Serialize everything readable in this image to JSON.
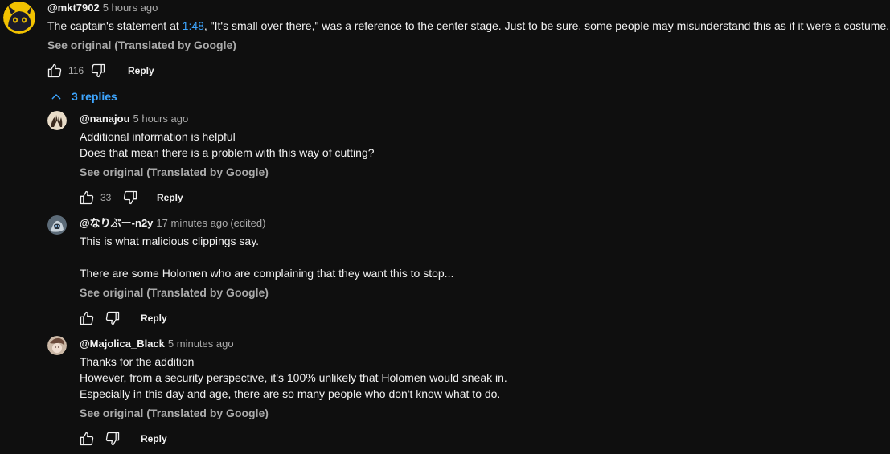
{
  "top_comment": {
    "author": "@mkt7902",
    "time": "5 hours ago",
    "text_before": "The captain's statement at ",
    "timestamp": "1:48",
    "text_after": ", \"It's small over there,\" was a reference to the center stage. Just to be sure, some people may misunderstand this as if it were a costume.",
    "see_original": "See original (Translated by Google)",
    "likes": "116",
    "reply_label": "Reply"
  },
  "replies_toggle": {
    "label": "3 replies",
    "icon": "chevron-up-icon"
  },
  "replies": [
    {
      "author": "@nanajou",
      "time": "5 hours ago",
      "lines": [
        "Additional information is helpful",
        "Does that mean there is a problem with this way of cutting?"
      ],
      "see_original": "See original (Translated by Google)",
      "likes": "33",
      "reply_label": "Reply"
    },
    {
      "author": "@なりぶー-n2y",
      "time": "17 minutes ago",
      "edited": "(edited)",
      "lines": [
        "This is what malicious clippings say.",
        "",
        "There are some Holomen who are complaining that they want this to stop..."
      ],
      "see_original": "See original (Translated by Google)",
      "likes": "",
      "reply_label": "Reply"
    },
    {
      "author": "@Majolica_Black",
      "time": "5 minutes ago",
      "lines": [
        "Thanks for the addition",
        "However, from a security perspective, it's 100% unlikely that Holomen would sneak in.",
        "Especially in this day and age, there are so many people who don't know what to do."
      ],
      "see_original": "See original (Translated by Google)",
      "likes": "",
      "reply_label": "Reply"
    }
  ],
  "colors": {
    "background": "#0f0f0f",
    "link": "#3ea6ff",
    "secondary_text": "#aaaaaa",
    "primary_text": "#f1f1f1"
  }
}
